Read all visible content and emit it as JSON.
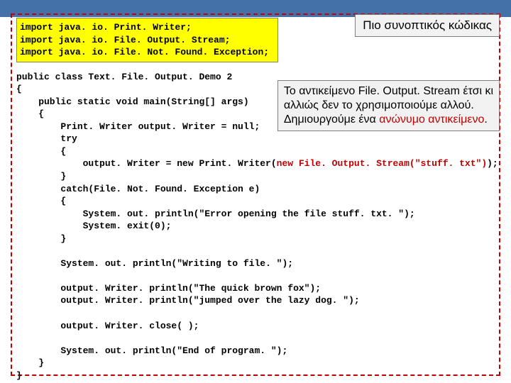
{
  "callouts": {
    "top": "Πιο συνοπτικός κώδικας",
    "mid_l1": "Το αντικείμενο File. Output. Stream έτσι κι",
    "mid_l2": "αλλιώς δεν το χρησιμοποιούμε αλλού.",
    "mid_l3a": "Δημιουργούμε ένα ",
    "mid_l3b": "ανώνυμο αντικείμενο",
    "mid_l3c": "."
  },
  "imports": {
    "l1": "import java. io. Print. Writer;",
    "l2": "import java. io. File. Output. Stream;",
    "l3": "import java. io. File. Not. Found. Exception;"
  },
  "code": {
    "c01": "public class Text. File. Output. Demo 2",
    "c02": "{",
    "c03": "    public static void main(String[] args)",
    "c04": "    {",
    "c05": "        Print. Writer output. Writer = null;",
    "c06": "        try",
    "c07": "        {",
    "c08a": "            output. Writer = new Print. Writer(",
    "c08b": "new File. Output. Stream(\"stuff. txt\")",
    "c08c": ");",
    "c09": "        }",
    "c10": "        catch(File. Not. Found. Exception e)",
    "c11": "        {",
    "c12": "            System. out. println(\"Error opening the file stuff. txt. \");",
    "c13": "            System. exit(0);",
    "c14": "        }",
    "c15": "",
    "c16": "        System. out. println(\"Writing to file. \");",
    "c17": "",
    "c18": "        output. Writer. println(\"The quick brown fox\");",
    "c19": "        output. Writer. println(\"jumped over the lazy dog. \");",
    "c20": "",
    "c21": "        output. Writer. close( );",
    "c22": "",
    "c23": "        System. out. println(\"End of program. \");",
    "c24": "    }",
    "c25": "}"
  }
}
